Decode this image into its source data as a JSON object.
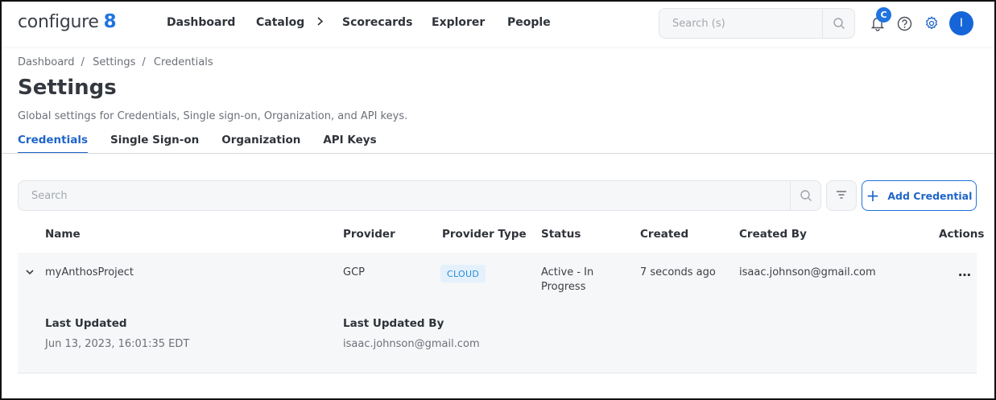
{
  "brand": {
    "name": "configure",
    "mark": "8",
    "accent": "#1f74e0"
  },
  "nav": [
    "Dashboard",
    "Catalog",
    "Scorecards",
    "Explorer",
    "People"
  ],
  "top_search": {
    "placeholder": "Search (s)"
  },
  "notifications": {
    "badge": "C"
  },
  "user": {
    "initial": "I"
  },
  "breadcrumb": [
    "Dashboard",
    "Settings",
    "Credentials"
  ],
  "page": {
    "title": "Settings",
    "subtitle": "Global settings for Credentials, Single sign-on, Organization, and API keys."
  },
  "tabs": [
    "Credentials",
    "Single Sign-on",
    "Organization",
    "API Keys"
  ],
  "active_tab": "Credentials",
  "list": {
    "search_placeholder": "Search",
    "add_label": "Add Credential",
    "columns": [
      "Name",
      "Provider",
      "Provider Type",
      "Status",
      "Created",
      "Created By",
      "Actions"
    ],
    "rows": [
      {
        "name": "myAnthosProject",
        "provider": "GCP",
        "provider_type": "CLOUD",
        "status_line1": "Active - In",
        "status_line2": "Progress",
        "created": "7 seconds ago",
        "created_by": "isaac.johnson@gmail.com",
        "actions": "…",
        "details": {
          "last_updated_label": "Last Updated",
          "last_updated": "Jun 13, 2023, 16:01:35 EDT",
          "last_updated_by_label": "Last Updated By",
          "last_updated_by": "isaac.johnson@gmail.com"
        }
      }
    ]
  },
  "icons": [
    "search-icon",
    "bell-icon",
    "help-icon",
    "gear-icon",
    "filter-icon",
    "plus-icon",
    "chevron-down-icon",
    "chevron-right-icon",
    "more-icon"
  ]
}
